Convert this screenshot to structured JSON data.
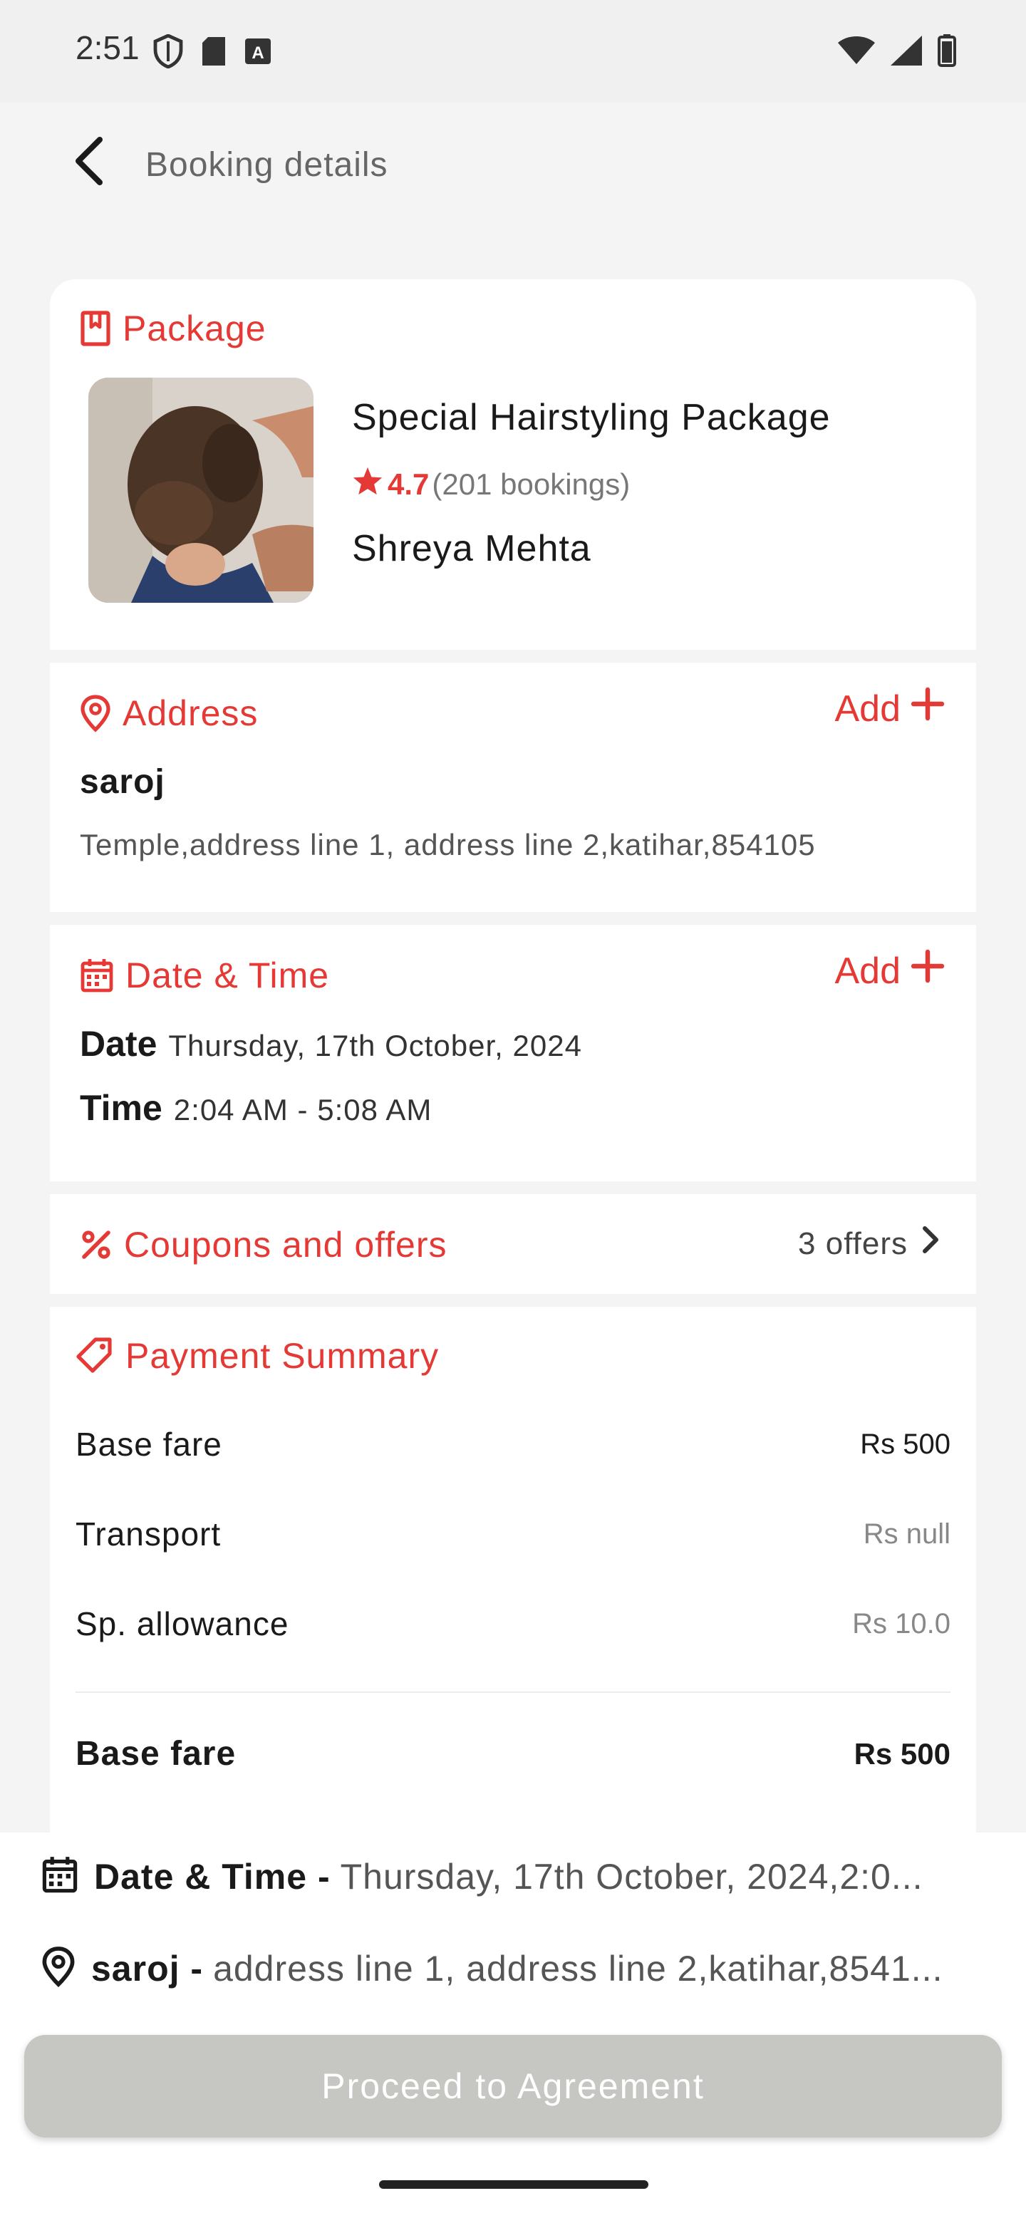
{
  "status_bar": {
    "time": "2:51"
  },
  "app_bar": {
    "title": "Booking details"
  },
  "package": {
    "section_title": "Package",
    "name": "Special Hairstyling Package",
    "rating": "4.7",
    "bookings": "(201 bookings)",
    "artist": "Shreya Mehta"
  },
  "address": {
    "section_title": "Address",
    "add_label": "Add",
    "name": "saroj",
    "line": "Temple,address line 1, address line 2,katihar,854105"
  },
  "datetime": {
    "section_title": "Date & Time",
    "add_label": "Add",
    "date_label": "Date",
    "date_value": "Thursday, 17th October, 2024",
    "time_label": "Time",
    "time_value": "2:04 AM - 5:08 AM"
  },
  "coupons": {
    "section_title": "Coupons and offers",
    "offers": "3 offers"
  },
  "payment": {
    "section_title": "Payment Summary",
    "rows": [
      {
        "label": "Base fare",
        "value": "Rs 500"
      },
      {
        "label": "Transport",
        "value": "Rs null"
      },
      {
        "label": "Sp. allowance",
        "value": "Rs 10.0"
      }
    ],
    "total": {
      "label": "Base fare",
      "value": "Rs 500"
    }
  },
  "bottom": {
    "dt_label": "Date & Time -",
    "dt_value": "Thursday, 17th October, 2024,2:0...",
    "addr_label": "saroj -",
    "addr_value": "address line 1, address line 2,katihar,8541...",
    "proceed_label": "Proceed to Agreement"
  },
  "colors": {
    "accent": "#e53935",
    "disabled_button": "#c6c6c2"
  }
}
